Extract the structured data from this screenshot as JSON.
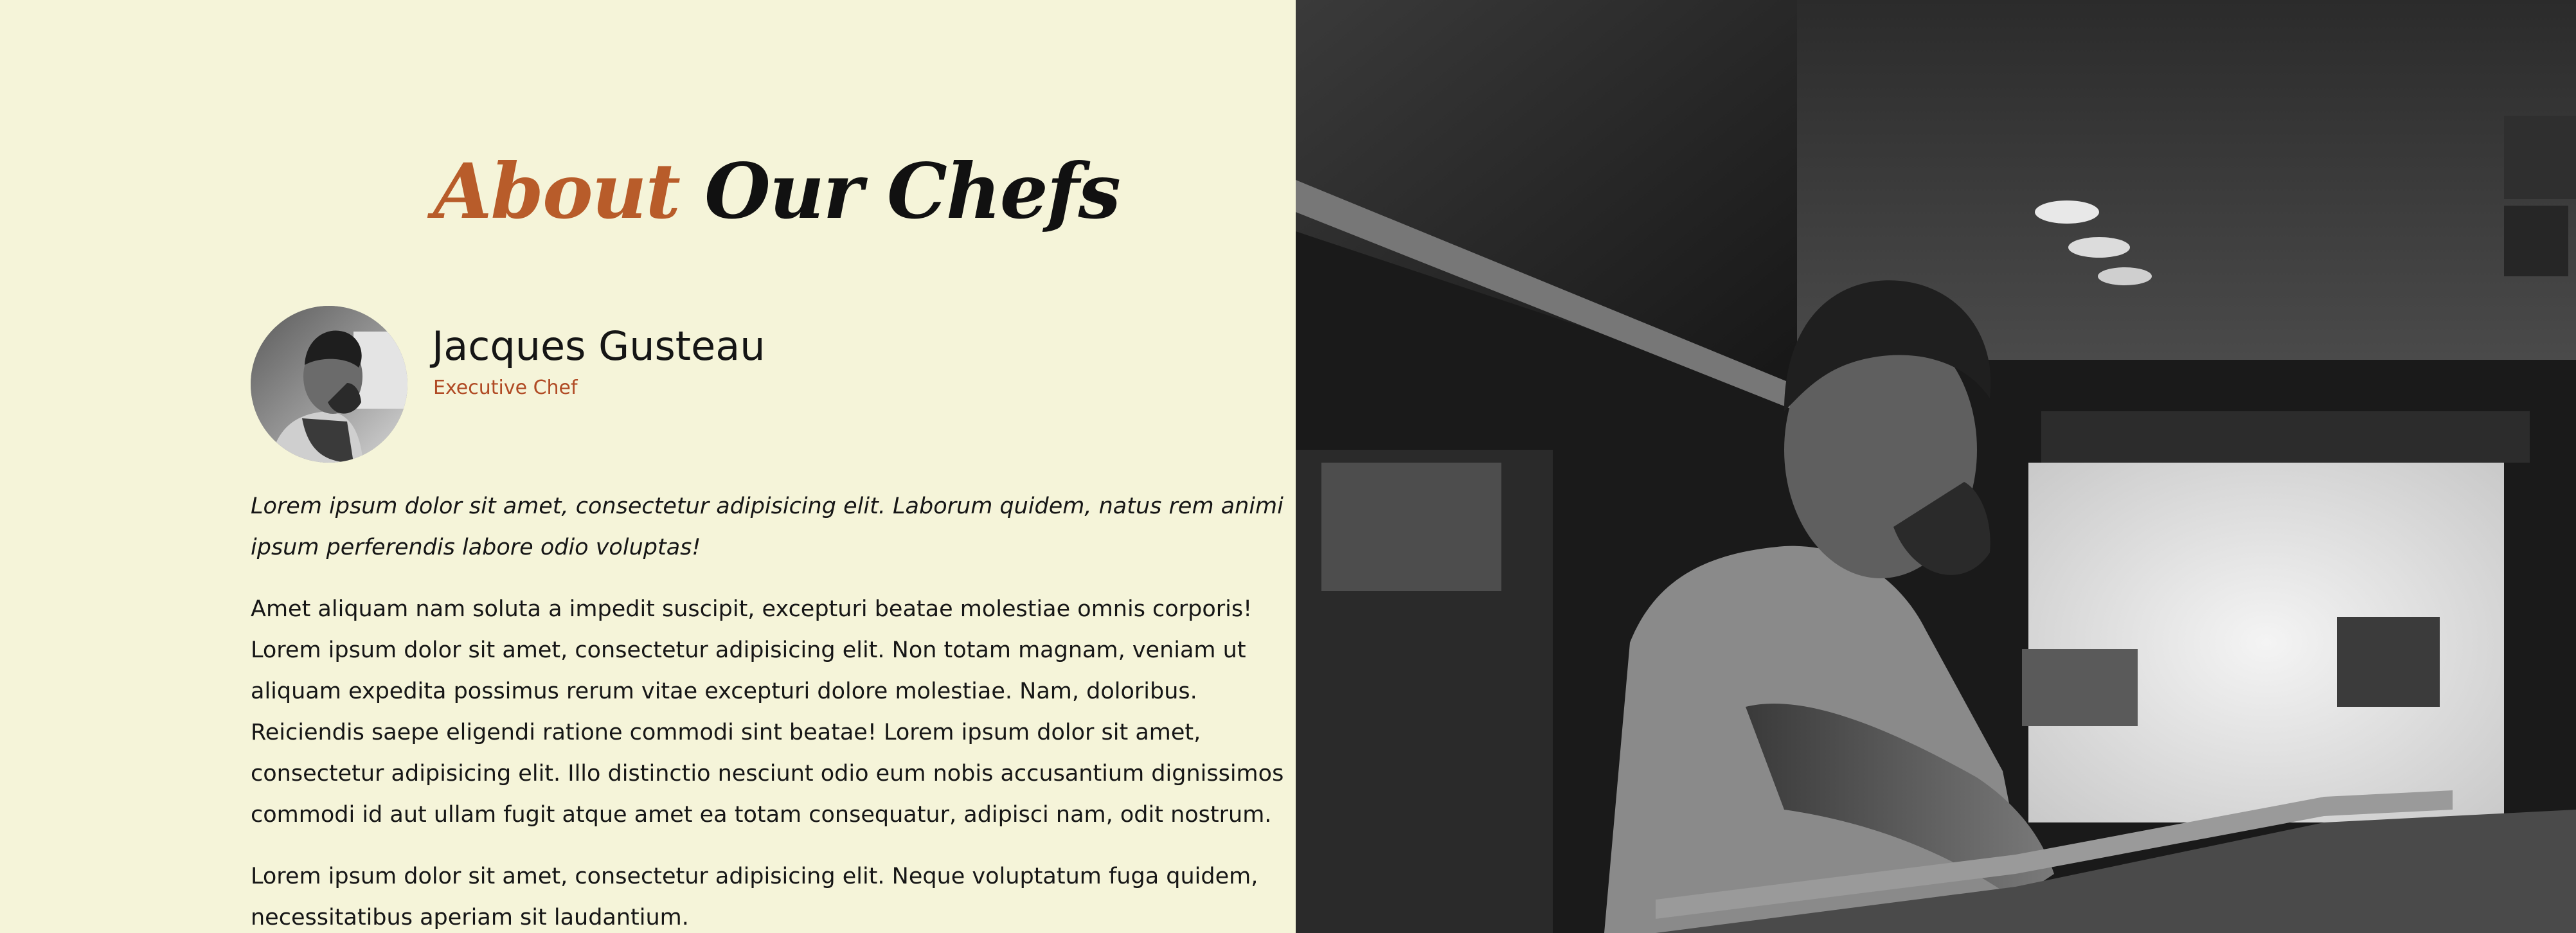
{
  "heading": {
    "accent": "About",
    "main": "Our Chefs"
  },
  "chef": {
    "name": "Jacques Gusteau",
    "role": "Executive Chef",
    "photo_alt": "chef portrait"
  },
  "bio": {
    "intro": "Lorem ipsum dolor sit amet, consectetur adipisicing elit. Laborum quidem, natus rem animi ipsum perferendis labore odio voluptas!",
    "paragraph_1": "Amet aliquam nam soluta a impedit suscipit, excepturi beatae molestiae omnis corporis! Lorem ipsum dolor sit amet, consectetur adipisicing elit. Non totam magnam, veniam ut aliquam expedita possimus rerum vitae excepturi dolore molestiae. Nam, doloribus. Reiciendis saepe eligendi ratione commodi sint beatae! Lorem ipsum dolor sit amet, consectetur adipisicing elit. Illo distinctio nesciunt odio eum nobis accusantium dignissimos commodi id aut ullam fugit atque amet ea totam consequatur, adipisci nam, odit nostrum.",
    "paragraph_2": "Lorem ipsum dolor sit amet, consectetur adipisicing elit. Neque voluptatum fuga quidem, necessitatibus aperiam sit laudantium."
  },
  "colors": {
    "background": "#f5f4d9",
    "accent": "#b85c2a",
    "role": "#b04a24",
    "text": "#161616"
  }
}
